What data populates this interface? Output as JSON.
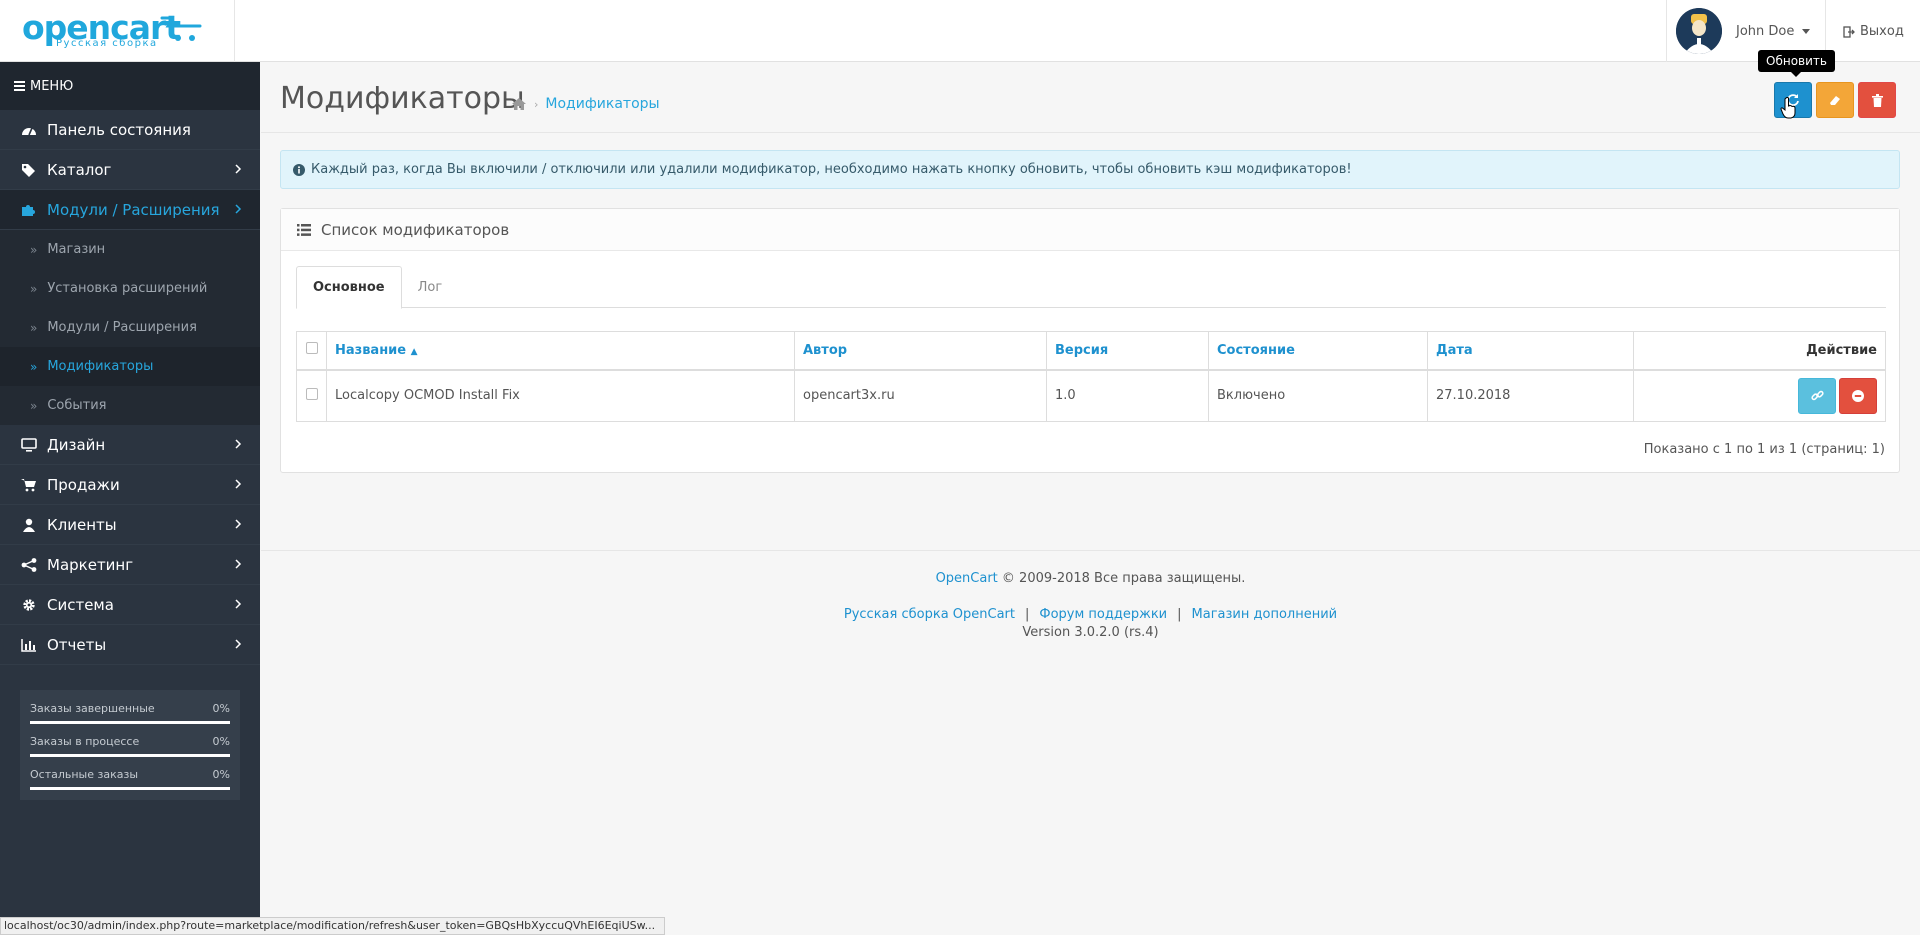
{
  "header": {
    "logo_text": "opencart",
    "logo_sub": "Русская сборка",
    "user_name": "John Doe",
    "logout_label": "Выход"
  },
  "sidebar": {
    "menu_title": "Меню",
    "items": [
      {
        "label": "Панель состояния",
        "icon": "dashboard-icon"
      },
      {
        "label": "Каталог",
        "icon": "tags-icon"
      },
      {
        "label": "Модули / Расширения",
        "icon": "puzzle-icon"
      },
      {
        "label": "Дизайн",
        "icon": "desktop-icon"
      },
      {
        "label": "Продажи",
        "icon": "cart-icon"
      },
      {
        "label": "Клиенты",
        "icon": "user-icon"
      },
      {
        "label": "Маркетинг",
        "icon": "share-icon"
      },
      {
        "label": "Система",
        "icon": "cog-icon"
      },
      {
        "label": "Отчеты",
        "icon": "bar-chart-icon"
      }
    ],
    "sub_items": [
      {
        "label": "Магазин"
      },
      {
        "label": "Установка расширений"
      },
      {
        "label": "Модули / Расширения"
      },
      {
        "label": "Модификаторы"
      },
      {
        "label": "События"
      }
    ],
    "stats": [
      {
        "label": "Заказы завершенные",
        "value": "0%"
      },
      {
        "label": "Заказы в процессе",
        "value": "0%"
      },
      {
        "label": "Остальные заказы",
        "value": "0%"
      }
    ]
  },
  "page": {
    "title": "Модификаторы",
    "breadcrumb": "Модификаторы",
    "tooltip": "Обновить",
    "alert": "Каждый раз, когда Вы включили / отключили или удалили модификатор, необходимо нажать кнопку обновить, чтобы обновить кэш модификаторов!",
    "panel_title": "Список модификаторов",
    "tabs": [
      "Основное",
      "Лог"
    ],
    "columns": {
      "name": "Название",
      "author": "Автор",
      "version": "Версия",
      "status": "Состояние",
      "date": "Дата",
      "action": "Действие"
    },
    "rows": [
      {
        "name": "Localcopy OCMOD Install Fix",
        "author": "opencart3x.ru",
        "version": "1.0",
        "status": "Включено",
        "date": "27.10.2018"
      }
    ],
    "pagination": "Показано с 1 по 1 из 1 (страниц: 1)"
  },
  "footer": {
    "brand": "OpenCart",
    "copy": "© 2009-2018 Все права защищены.",
    "links": [
      "Русская сборка OpenCart",
      "Форум поддержки",
      "Магазин дополнений"
    ],
    "version": "Version 3.0.2.0 (rs.4)"
  },
  "statusbar": "localhost/oc30/admin/index.php?route=marketplace/modification/refresh&user_token=GBQsHbXyccuQVhEI6EqiUSw...",
  "colors": {
    "accent": "#1e91cf",
    "sidebar": "#2b3440",
    "warning": "#f3a638",
    "danger": "#e3503e",
    "info": "#5bc0de"
  }
}
